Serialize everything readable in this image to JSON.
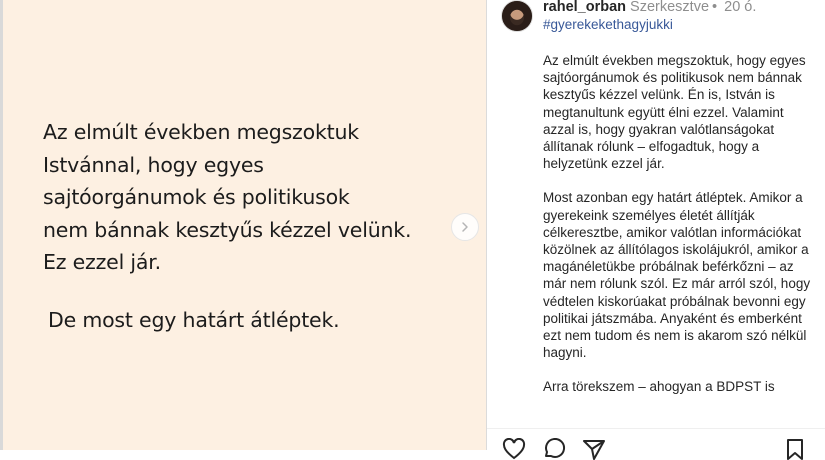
{
  "slide": {
    "paragraph1": [
      "Az elmúlt években megszoktuk",
      "Istvánnal, hogy egyes",
      "sajtóorgánumok és politikusok",
      "nem bánnak kesztyűs kézzel velünk.",
      "Ez ezzel jár."
    ],
    "paragraph2": "De most egy határt átléptek.",
    "background": "#fdf0e2"
  },
  "post": {
    "username": "rahel_orban",
    "edited_label": "Szerkesztve",
    "separator": "•",
    "time": "20 ó.",
    "hashtag": "#gyerekekethagyjukki",
    "caption": [
      "Az elmúlt években megszoktuk, hogy egyes sajtóorgánumok és politikusok nem bánnak kesztyűs kézzel velünk. Én is, István is megtanultunk együtt élni ezzel. Valamint azzal is, hogy gyakran valótlanságokat állítanak rólunk – elfogadtuk, hogy a helyzetünk ezzel jár.",
      "Most azonban egy határt átléptek. Amikor a gyerekeink személyes életét állítják célkeresztbe, amikor valótlan információkat közölnek az állítólagos iskolájukról, amikor a magánéletükbe próbálnak beférkőzni – az már nem rólunk szól. Ez már arról szól, hogy védtelen kiskorúakat próbálnak bevonni egy politikai játszmába. Anyaként és emberként ezt nem tudom és nem is akarom szó nélkül hagyni.",
      "Arra törekszem – ahogyan a BDPST is"
    ]
  },
  "icons": {
    "next": "chevron-right-icon",
    "like": "heart-icon",
    "comment": "comment-icon",
    "share": "paper-plane-icon",
    "save": "bookmark-icon"
  }
}
